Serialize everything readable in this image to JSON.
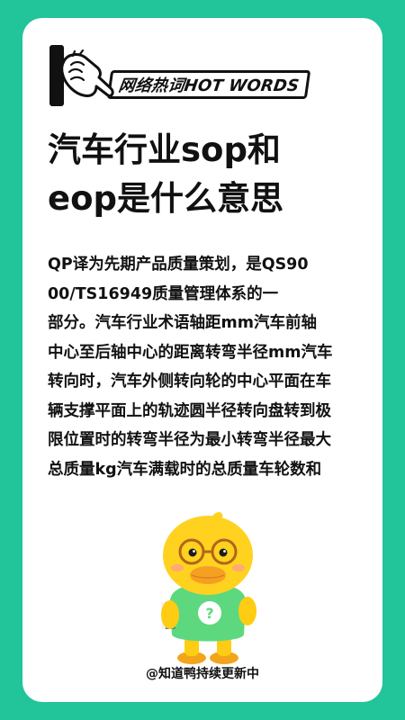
{
  "badge": {
    "label": "网络热词HOT WORDS",
    "icon": "pointing-hand-icon"
  },
  "article": {
    "title_lines": [
      "汽车行业sop和",
      "eop是什么意思"
    ],
    "body_lines": [
      "QP译为先期产品质量策划，是QS90",
      "00/TS16949质量管理体系的一",
      "部分。汽车行业术语轴距mm汽车前轴",
      "中心至后轴中心的距离转弯半径mm汽车",
      "转向时，汽车外侧转向轮的中心平面在车",
      "辆支撑平面上的轨迹圆半径转向盘转到极",
      "限位置时的转弯半径为最小转弯半径最大",
      "总质量kg汽车满载时的总质量车轮数和"
    ]
  },
  "mascot": {
    "icon": "duck-mascot-icon",
    "shirt_symbol": "?"
  },
  "footer": {
    "text": "@知道鸭持续更新中"
  },
  "colors": {
    "background": "#22c49a",
    "card": "#ffffff",
    "text": "#111111",
    "duck_yellow": "#ffd21f",
    "shirt_green": "#5ed87e"
  }
}
